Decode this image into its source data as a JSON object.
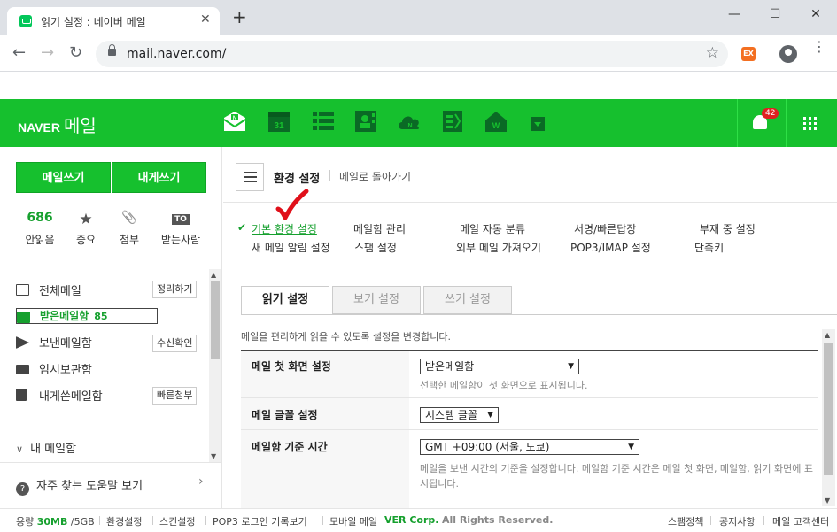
{
  "browser": {
    "tab_title": "읽기 설정 : 네이버 메일",
    "tab_close": "✕",
    "new_tab": "+",
    "url": "mail.naver.com/",
    "ext_label": "EX"
  },
  "window": {
    "minimize": "—",
    "maximize": "☐",
    "close": "✕"
  },
  "header": {
    "logo_naver": "NAVER",
    "logo_mail": "메일",
    "calendar_day": "31",
    "notification_count": "42"
  },
  "sidebar": {
    "write_button": "메일쓰기",
    "self_write_button": "내게쓰기",
    "stats": [
      {
        "value": "686",
        "label": "안읽음"
      },
      {
        "value": "★",
        "label": "중요"
      },
      {
        "value": "📎",
        "label": "첨부"
      },
      {
        "value": "TO",
        "label": "받는사람"
      }
    ],
    "mailboxes": [
      {
        "label": "전체메일",
        "tag": "정리하기"
      },
      {
        "label": "받은메일함",
        "count": "85"
      },
      {
        "label": "보낸메일함",
        "tag": "수신확인"
      },
      {
        "label": "임시보관함"
      },
      {
        "label": "내게쓴메일함",
        "tag": "빠른첨부"
      }
    ],
    "my_mailbox": "내 메일함",
    "help": "자주 찾는 도움말 보기"
  },
  "content": {
    "title": "환경 설정",
    "back_link": "메일로 돌아가기",
    "settings_menu": [
      "기본 환경 설정",
      "메일함 관리",
      "메일 자동 분류",
      "서명/빠른답장",
      "부재 중 설정",
      "새 메일 알림 설정",
      "스팸 설정",
      "외부 메일 가져오기",
      "POP3/IMAP 설정",
      "단축키"
    ],
    "subtabs": [
      "읽기 설정",
      "보기 설정",
      "쓰기 설정"
    ],
    "description": "메일을 편리하게 읽을 수 있도록 설정을 변경합니다.",
    "rows": [
      {
        "label": "메일 첫 화면 설정",
        "select": "받은메일함",
        "note": "선택한 메일함이 첫 화면으로 표시됩니다."
      },
      {
        "label": "메일 글꼴 설정",
        "select": "시스템 글꼴"
      },
      {
        "label": "메일함 기준 시간",
        "select": "GMT +09:00 (서울, 도쿄)",
        "note": "메일을 보낸 시간의 기준을 설정합니다. 메일함 기준 시간은 메일 첫 화면, 메일함, 읽기 화면에 표시됩니다."
      }
    ]
  },
  "footer": {
    "capacity_prefix": "용량",
    "capacity_used": "30MB",
    "capacity_total": "/5GB",
    "links_left": [
      "환경설정",
      "스킨설정",
      "POP3 로그인 기록보기",
      "모바일 메일"
    ],
    "copyright_brand": "VER Corp.",
    "copyright_text": "All Rights Reserved.",
    "links_right": [
      "스팸정책",
      "공지사항",
      "메일 고객센터"
    ]
  }
}
